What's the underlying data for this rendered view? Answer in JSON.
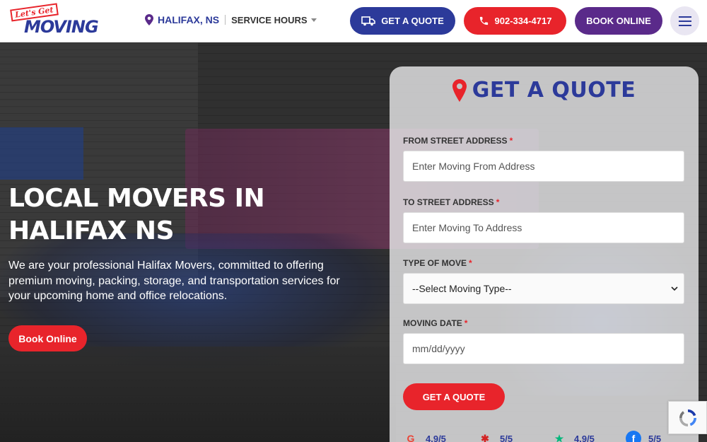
{
  "header": {
    "logo_tag": "Let's Get",
    "logo_word": "MOVING",
    "location": "HALIFAX, NS",
    "service_hours": "SERVICE HOURS",
    "quote_button": "GET A QUOTE",
    "phone_button": "902-334-4717",
    "book_button": "BOOK ONLINE"
  },
  "hero": {
    "title": "LOCAL MOVERS IN HALIFAX NS",
    "description": "We are your professional Halifax Movers, committed to offering premium moving, packing, storage, and transportation services for your upcoming home and office relocations.",
    "book_button": "Book Online"
  },
  "quote_form": {
    "heading": "GET A QUOTE",
    "from_label": "FROM STREET ADDRESS",
    "from_placeholder": "Enter Moving From Address",
    "to_label": "TO STREET ADDRESS",
    "to_placeholder": "Enter Moving To Address",
    "type_label": "TYPE OF MOVE",
    "type_selected": "--Select Moving Type--",
    "date_label": "MOVING DATE",
    "date_placeholder": "mm/dd/yyyy",
    "required_mark": "*",
    "submit": "GET A QUOTE"
  },
  "ratings": [
    {
      "source": "google-icon",
      "score": "4.9/5",
      "color": "#ea4335"
    },
    {
      "source": "yelp-icon",
      "score": "5/5",
      "color": "#d32323"
    },
    {
      "source": "trustpilot-icon",
      "score": "4.9/5",
      "color": "#00b67a"
    },
    {
      "source": "facebook-icon",
      "score": "5/5",
      "color": "#1877f2"
    }
  ],
  "colors": {
    "brand_blue": "#2c3a9a",
    "brand_red": "#e8242b",
    "brand_purple": "#5a2a8a"
  }
}
